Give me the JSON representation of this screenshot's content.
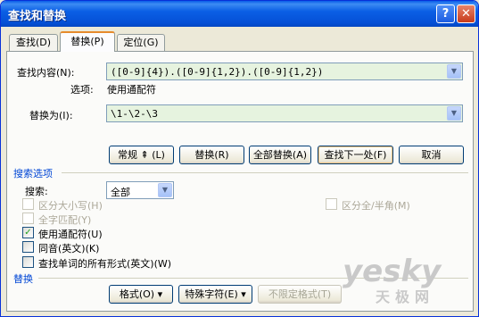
{
  "window": {
    "title": "查找和替换",
    "help_label": "?",
    "close_label": "✕"
  },
  "tabs": [
    {
      "label": "查找(D)"
    },
    {
      "label": "替换(P)"
    },
    {
      "label": "定位(G)"
    }
  ],
  "find": {
    "label": "查找内容(N):",
    "value": "([0-9]{4}).([0-9]{1,2}).([0-9]{1,2})",
    "options_label": "选项:",
    "options_value": "使用通配符"
  },
  "replace": {
    "label": "替换为(I):",
    "value": "\\1-\\2-\\3"
  },
  "buttons": {
    "normal": "常规 ⇞ (L)",
    "replace": "替换(R)",
    "replace_all": "全部替换(A)",
    "find_next": "查找下一处(F)",
    "cancel": "取消"
  },
  "search_options": {
    "title": "搜索选项",
    "search_label": "搜索:",
    "search_value": "全部",
    "match_case": "区分大小写(H)",
    "whole_word": "全字匹配(Y)",
    "use_wildcards": "使用通配符(U)",
    "sounds_like": "同音(英文)(K)",
    "all_forms": "查找单词的所有形式(英文)(W)",
    "match_width": "区分全/半角(M)"
  },
  "replace_section": {
    "title": "替换",
    "format": "格式(O) ▾",
    "special": "特殊字符(E) ▾",
    "no_format": "不限定格式(T)"
  },
  "watermark": {
    "main": "yesky",
    "sub": "天极网"
  }
}
